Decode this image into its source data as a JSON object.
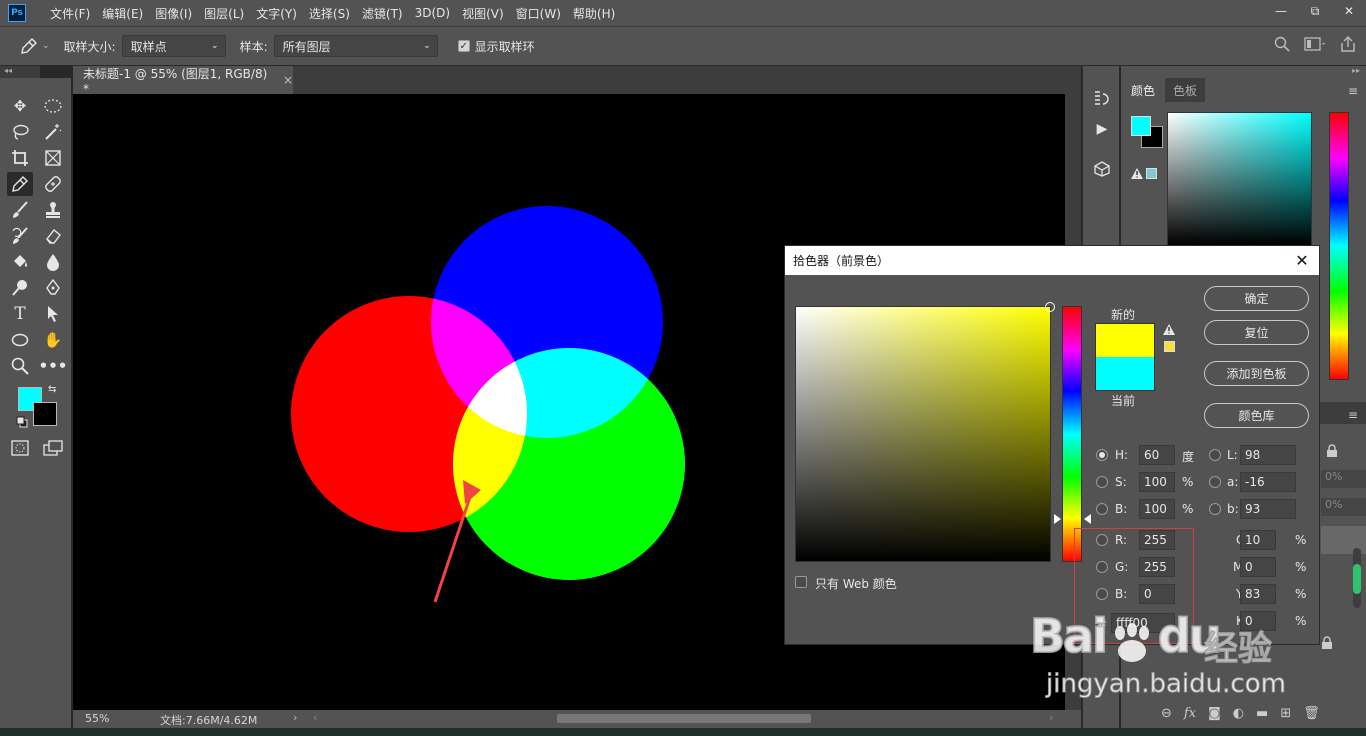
{
  "menu": {
    "app_icon": "Ps",
    "items": [
      "文件(F)",
      "编辑(E)",
      "图像(I)",
      "图层(L)",
      "文字(Y)",
      "选择(S)",
      "滤镜(T)",
      "3D(D)",
      "视图(V)",
      "窗口(W)",
      "帮助(H)"
    ]
  },
  "window_controls": {
    "minimize": "—",
    "restore": "⧉",
    "close": "✕"
  },
  "options": {
    "sample_size_label": "取样大小:",
    "sample_size_value": "取样点",
    "sample_label": "样本:",
    "sample_value": "所有图层",
    "show_ring_label": "显示取样环",
    "show_ring_checked": true
  },
  "document": {
    "tab_title": "未标题-1 @ 55% (图层1, RGB/8) *",
    "tab_close": "×",
    "zoom": "55%",
    "doc_info": "文档:7.66M/4.62M"
  },
  "toolbox": {
    "foreground_color": "#00ffff",
    "background_color": "#000000"
  },
  "right_panel": {
    "tabs": [
      "颜色",
      "色板"
    ],
    "foreground_color": "#00ffff",
    "opacity_1": "0%",
    "opacity_2": "0%"
  },
  "picker": {
    "title": "拾色器（前景色）",
    "close": "✕",
    "new_label": "新的",
    "current_label": "当前",
    "new_color": "#ffff00",
    "current_color": "#00ffff",
    "buttons": {
      "ok": "确定",
      "reset": "复位",
      "add_swatch": "添加到色板",
      "libraries": "颜色库"
    },
    "web_only_label": "只有 Web 颜色",
    "hsb": {
      "h_label": "H:",
      "h": "60",
      "h_unit": "度",
      "s_label": "S:",
      "s": "100",
      "s_unit": "%",
      "b_label": "B:",
      "b": "100",
      "b_unit": "%"
    },
    "lab": {
      "l_label": "L:",
      "l": "98",
      "a_label": "a:",
      "a": "-16",
      "b_label": "b:",
      "b": "93"
    },
    "rgb": {
      "r_label": "R:",
      "r": "255",
      "g_label": "G:",
      "g": "255",
      "b_label": "B:",
      "b": "0"
    },
    "cmyk": {
      "c_label": "C:",
      "c": "10",
      "m_label": "M:",
      "m": "0",
      "y_label": "Y:",
      "y": "83",
      "k_label": "K:",
      "k": "0",
      "unit": "%"
    },
    "hex_label": "#",
    "hex": "ffff00"
  },
  "watermark": {
    "brand": "Bai",
    "brand2": "du",
    "cn": "经验",
    "url": "jingyan.baidu.com"
  }
}
